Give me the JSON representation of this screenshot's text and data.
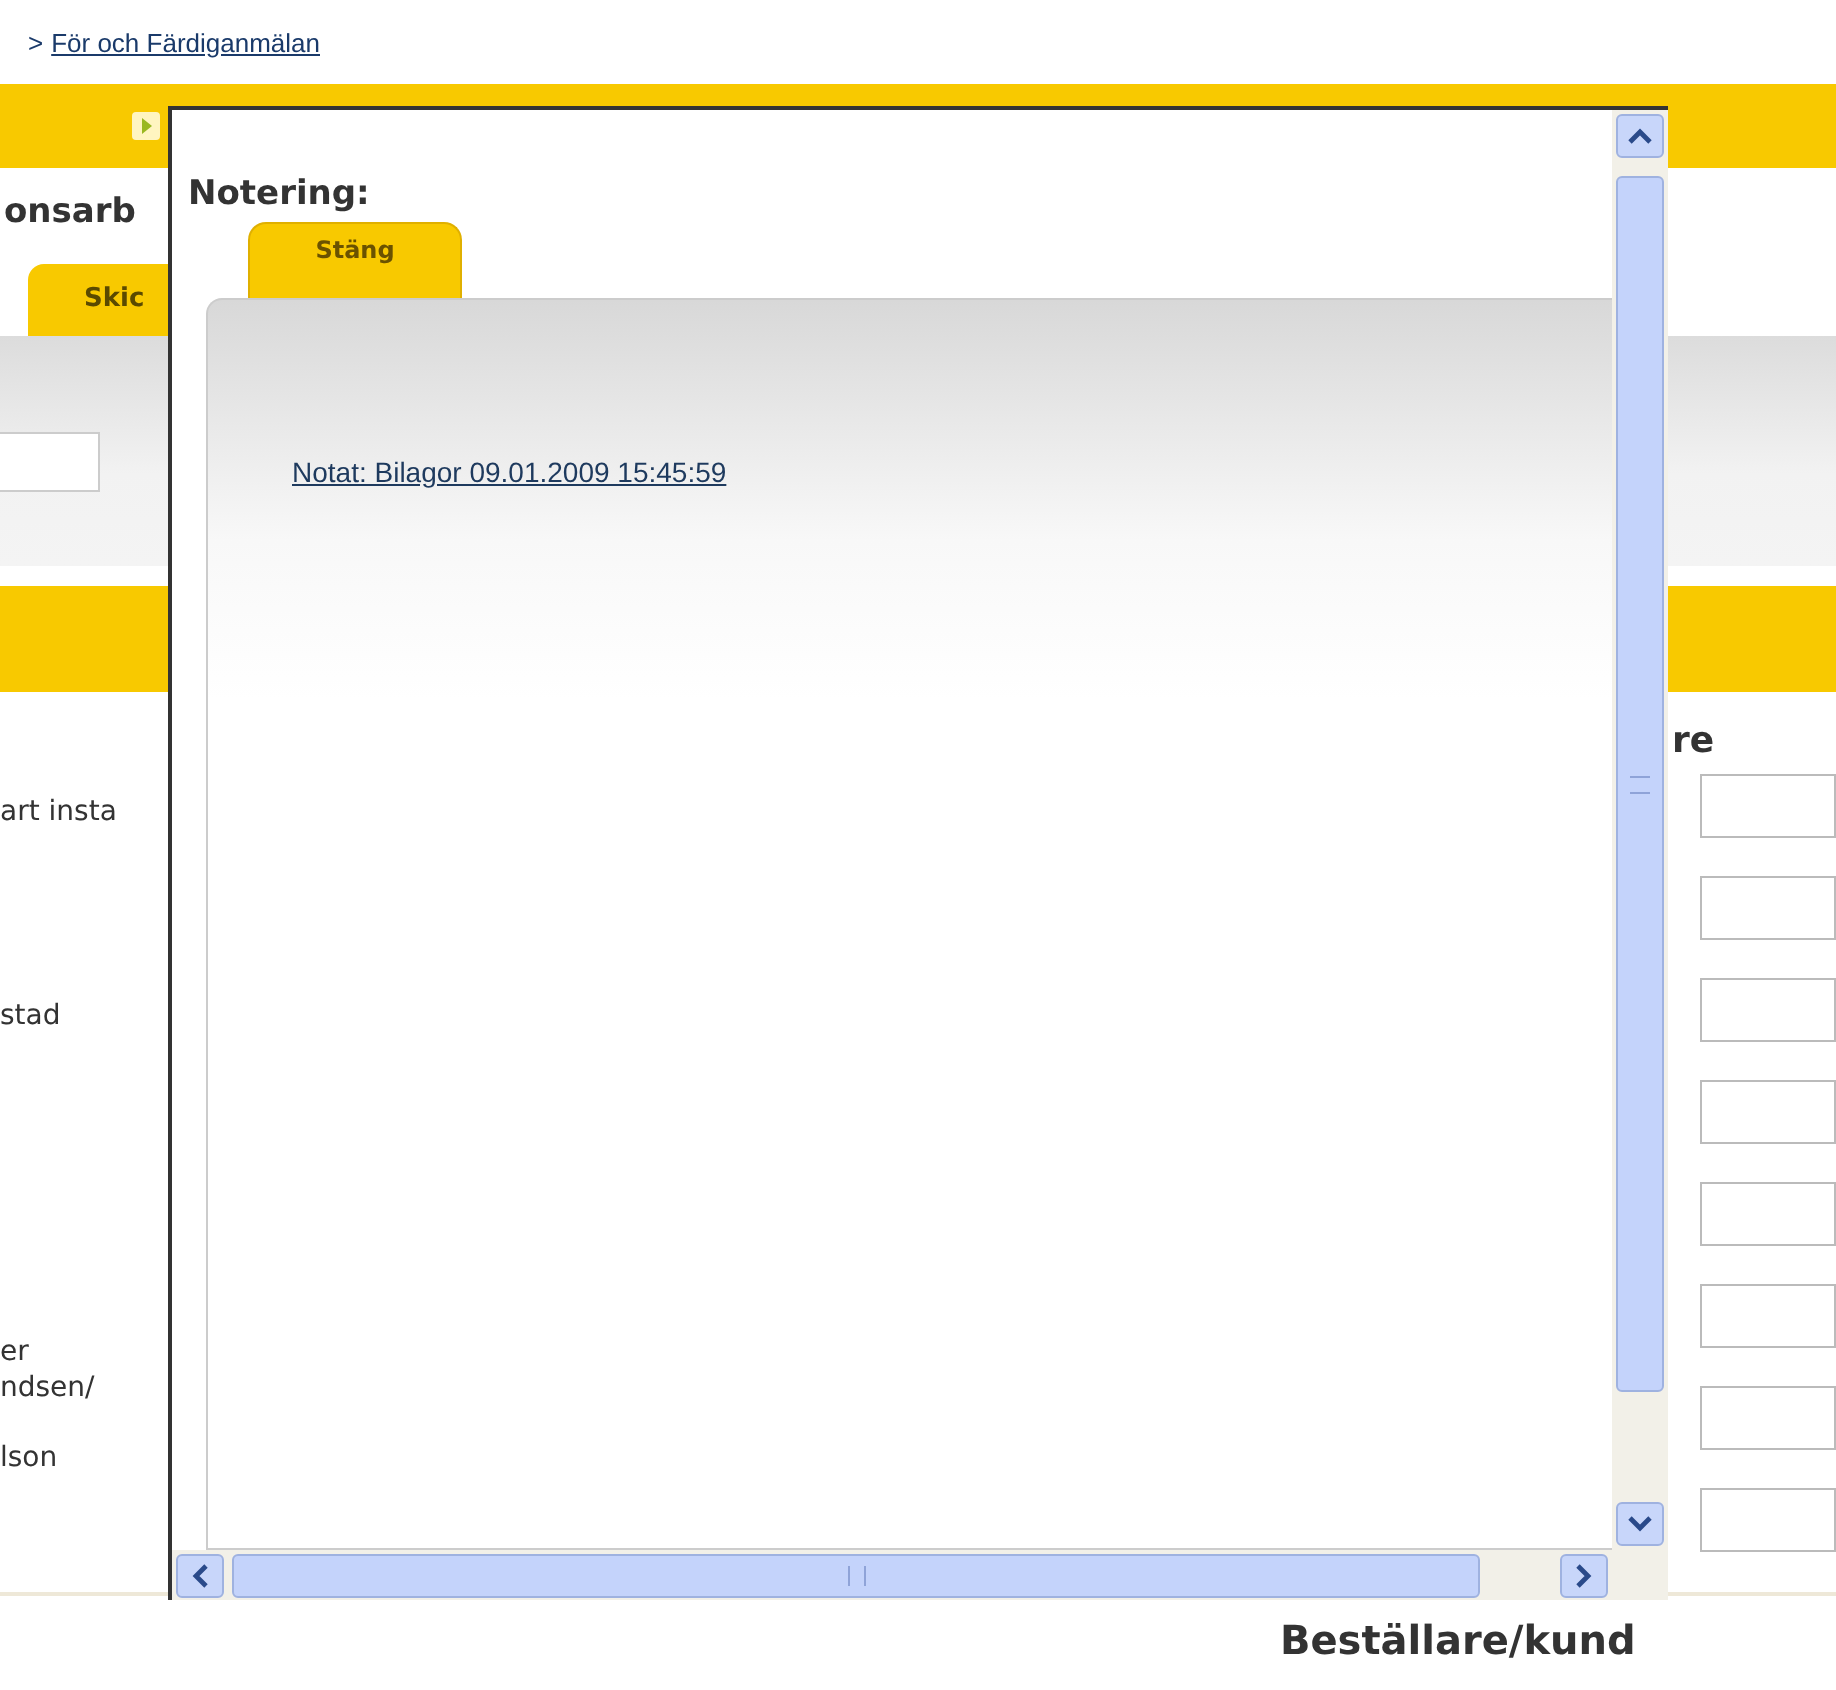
{
  "breadcrumb": {
    "separator": ">",
    "link": "För och Färdiganmälan"
  },
  "page": {
    "heading": "onsarb",
    "tab": "Skic",
    "labels": [
      "art insta",
      "stad",
      "er",
      "ndsen/",
      "lson"
    ],
    "right_heading": "re",
    "footer_heading": "Beställare/kund"
  },
  "popup": {
    "title": "Notering:",
    "tabs": [
      {
        "label": "Stäng",
        "selected": true
      }
    ],
    "note_link": "Notat: Bilagor 09.01.2009 15:45:59"
  }
}
